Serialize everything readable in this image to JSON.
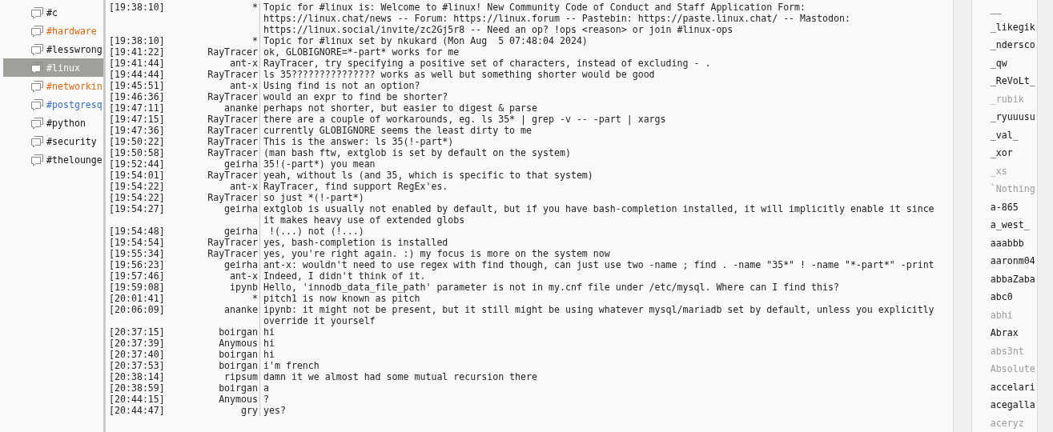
{
  "channels": [
    {
      "name": "#c",
      "selected": false
    },
    {
      "name": "#hardware",
      "selected": false,
      "color": "#e0670f"
    },
    {
      "name": "#lesswrong",
      "selected": false
    },
    {
      "name": "#linux",
      "selected": true
    },
    {
      "name": "#networkin",
      "selected": false,
      "color": "#e0670f"
    },
    {
      "name": "#postgresq",
      "selected": false,
      "color": "#3a6fc6"
    },
    {
      "name": "#python",
      "selected": false
    },
    {
      "name": "#security",
      "selected": false
    },
    {
      "name": "#thelounge",
      "selected": false
    }
  ],
  "messages": [
    {
      "time": "[19:38:10]",
      "nick": "*",
      "text": "Topic for #linux is: Welcome to #linux! New Community Code of Conduct and Staff Application Form: https://linux.chat/news -- Forum: https://linux.forum -- Pastebin: https://paste.linux.chat/ -- Mastodon: https://linux.social/invite/zc2Gj5r8 -- Need an op? !ops <reason> or join #linux-ops"
    },
    {
      "time": "[19:38:10]",
      "nick": "*",
      "text": "Topic for #linux set by nkukard (Mon Aug  5 07:48:04 2024)"
    },
    {
      "time": "[19:41:22]",
      "nick": "RayTracer",
      "text": "ok, GLOBIGNORE=*-part* works for me"
    },
    {
      "time": "[19:41:44]",
      "nick": "ant-x",
      "text": "RayTracer, try specifying a positive set of characters, instead of excluding - ."
    },
    {
      "time": "[19:44:44]",
      "nick": "RayTracer",
      "text": "ls 35??????????????? works as well but something shorter would be good"
    },
    {
      "time": "[19:45:51]",
      "nick": "ant-x",
      "text": "Using find is not an option?"
    },
    {
      "time": "[19:46:36]",
      "nick": "RayTracer",
      "text": "would an expr to find be shorter?"
    },
    {
      "time": "[19:47:11]",
      "nick": "ananke",
      "text": "perhaps not shorter, but easier to digest & parse"
    },
    {
      "time": "[19:47:15]",
      "nick": "RayTracer",
      "text": "there are a couple of workarounds, eg. ls 35* | grep -v -- -part | xargs"
    },
    {
      "time": "[19:47:36]",
      "nick": "RayTracer",
      "text": "currently GLOBIGNORE seems the least dirty to me"
    },
    {
      "time": "[19:50:22]",
      "nick": "RayTracer",
      "text": "This is the answer: ls 35(!-part*)"
    },
    {
      "time": "[19:50:58]",
      "nick": "RayTracer",
      "text": "(man bash ftw, extglob is set by default on the system)"
    },
    {
      "time": "[19:52:44]",
      "nick": "geirha",
      "text": "35!(-part*) you mean"
    },
    {
      "time": "[19:54:01]",
      "nick": "RayTracer",
      "text": "yeah, without ls (and 35, which is specific to that system)"
    },
    {
      "time": "[19:54:22]",
      "nick": "ant-x",
      "text": "RayTracer, find support RegEx'es."
    },
    {
      "time": "[19:54:22]",
      "nick": "RayTracer",
      "text": "so just *(!-part*)"
    },
    {
      "time": "[19:54:27]",
      "nick": "geirha",
      "text": "extglob is usually not enabled by default, but if you have bash-completion installed, it will implicitly enable it since it makes heavy use of extended globs"
    },
    {
      "time": "[19:54:48]",
      "nick": "geirha",
      "text": " !(...) not (!...)"
    },
    {
      "time": "[19:54:54]",
      "nick": "RayTracer",
      "text": "yes, bash-completion is installed"
    },
    {
      "time": "[19:55:34]",
      "nick": "RayTracer",
      "text": "yes, you're right again. :) my focus is more on the system now"
    },
    {
      "time": "[19:56:23]",
      "nick": "geirha",
      "text": "ant-x: wouldn't need to use regex with find though, can just use two -name ; find . -name \"35*\" ! -name \"*-part*\" -print"
    },
    {
      "time": "[19:57:46]",
      "nick": "ant-x",
      "text": "Indeed, I didn't think of it."
    },
    {
      "time": "[19:59:08]",
      "nick": "ipynb",
      "text": "Hello, 'innodb_data_file_path' parameter is not in my.cnf file under /etc/mysql. Where can I find this?"
    },
    {
      "time": "[20:01:41]",
      "nick": "*",
      "text": "pitch1 is now known as pitch"
    },
    {
      "time": "[20:06:09]",
      "nick": "ananke",
      "text": "ipynb: it might not be present, but it still might be using whatever mysql/mariadb set by default, unless you explicitly override it yourself"
    },
    {
      "time": "[20:37:15]",
      "nick": "boirgan",
      "text": "hi"
    },
    {
      "time": "[20:37:39]",
      "nick": "Anymous",
      "text": "hi"
    },
    {
      "time": "[20:37:40]",
      "nick": "boirgan",
      "text": "hi"
    },
    {
      "time": "[20:37:53]",
      "nick": "boirgan",
      "text": "i'm french"
    },
    {
      "time": "[20:38:14]",
      "nick": "ripsum",
      "text": "damn it we almost had some mutual recursion there"
    },
    {
      "time": "[20:38:59]",
      "nick": "boirgan",
      "text": "a"
    },
    {
      "time": "[20:44:15]",
      "nick": "Anymous",
      "text": "?"
    },
    {
      "time": "[20:44:47]",
      "nick": "gry",
      "text": "yes?"
    }
  ],
  "users": [
    {
      "name": "__",
      "away": false
    },
    {
      "name": "_likegik",
      "away": false
    },
    {
      "name": "_ndersco",
      "away": false
    },
    {
      "name": "_qw",
      "away": false
    },
    {
      "name": "_ReVoLt_",
      "away": false
    },
    {
      "name": "_rubik",
      "away": true
    },
    {
      "name": "_ryuuusu",
      "away": false
    },
    {
      "name": "_val_",
      "away": false
    },
    {
      "name": "_xor",
      "away": false
    },
    {
      "name": "_xs",
      "away": true
    },
    {
      "name": "`Nothing",
      "away": true
    },
    {
      "name": "a-865",
      "away": false
    },
    {
      "name": "a_west_",
      "away": false
    },
    {
      "name": "aaabbb",
      "away": false
    },
    {
      "name": "aaronm04",
      "away": false
    },
    {
      "name": "abbaZaba",
      "away": false
    },
    {
      "name": "abc0",
      "away": false
    },
    {
      "name": "abhi",
      "away": true
    },
    {
      "name": "Abrax",
      "away": false
    },
    {
      "name": "abs3nt",
      "away": true
    },
    {
      "name": "Absolute",
      "away": true
    },
    {
      "name": "accelari",
      "away": false
    },
    {
      "name": "acegalla",
      "away": false
    },
    {
      "name": "aceryz",
      "away": true
    }
  ]
}
